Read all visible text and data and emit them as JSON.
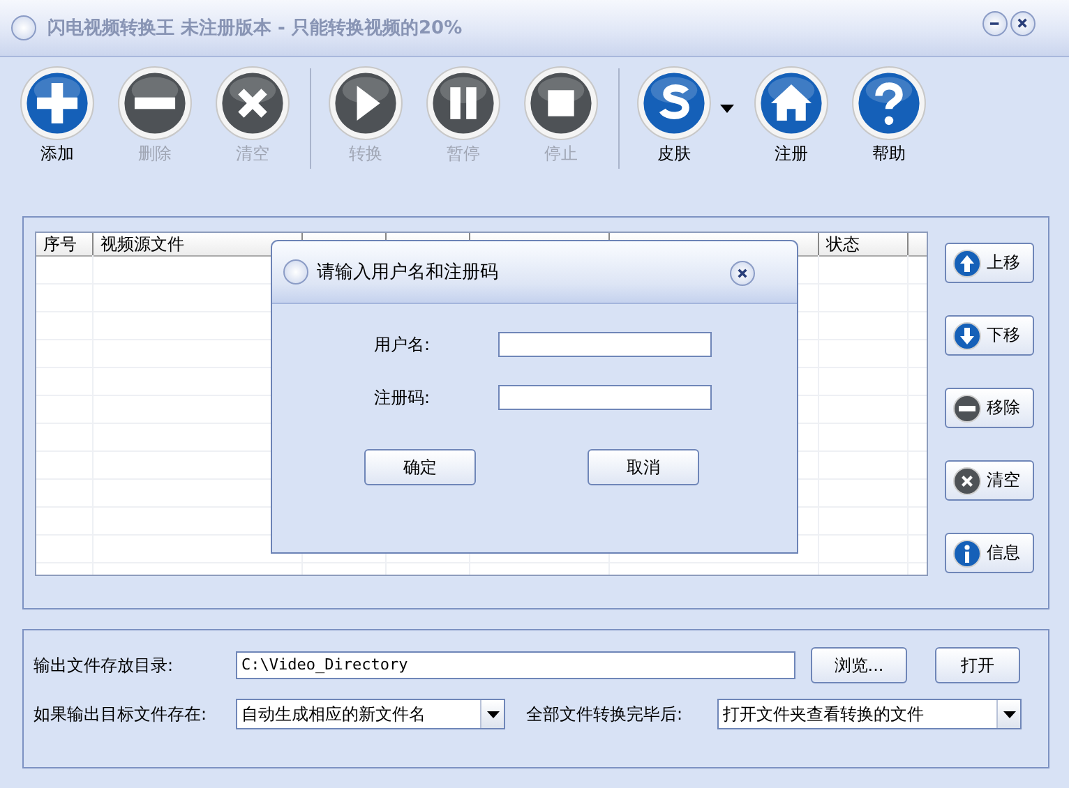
{
  "window": {
    "title": "闪电视频转换王 未注册版本 - 只能转换视频的20%"
  },
  "toolbar": [
    {
      "label": "添加",
      "disabled": false
    },
    {
      "label": "删除",
      "disabled": true
    },
    {
      "label": "清空",
      "disabled": true
    },
    {
      "label": "转换",
      "disabled": true
    },
    {
      "label": "暂停",
      "disabled": true
    },
    {
      "label": "停止",
      "disabled": true
    },
    {
      "label": "皮肤",
      "disabled": false
    },
    {
      "label": "注册",
      "disabled": false
    },
    {
      "label": "帮助",
      "disabled": false
    }
  ],
  "table": {
    "columns": [
      "序号",
      "视频源文件",
      "状态"
    ]
  },
  "side_buttons": [
    "上移",
    "下移",
    "移除",
    "清空",
    "信息"
  ],
  "dialog": {
    "title": "请输入用户名和注册码",
    "fields": [
      {
        "label": "用户名:"
      },
      {
        "label": "注册码:"
      }
    ],
    "buttons": [
      "确定",
      "取消"
    ]
  },
  "output": {
    "dir_label": "输出文件存放目录:",
    "dir_value": "C:\\Video_Directory",
    "browse": "浏览...",
    "open": "打开",
    "exists_label": "如果输出目标文件存在:",
    "exists_value": "自动生成相应的新文件名",
    "after_label": "全部文件转换完毕后:",
    "after_value": "打开文件夹查看转换的文件"
  }
}
